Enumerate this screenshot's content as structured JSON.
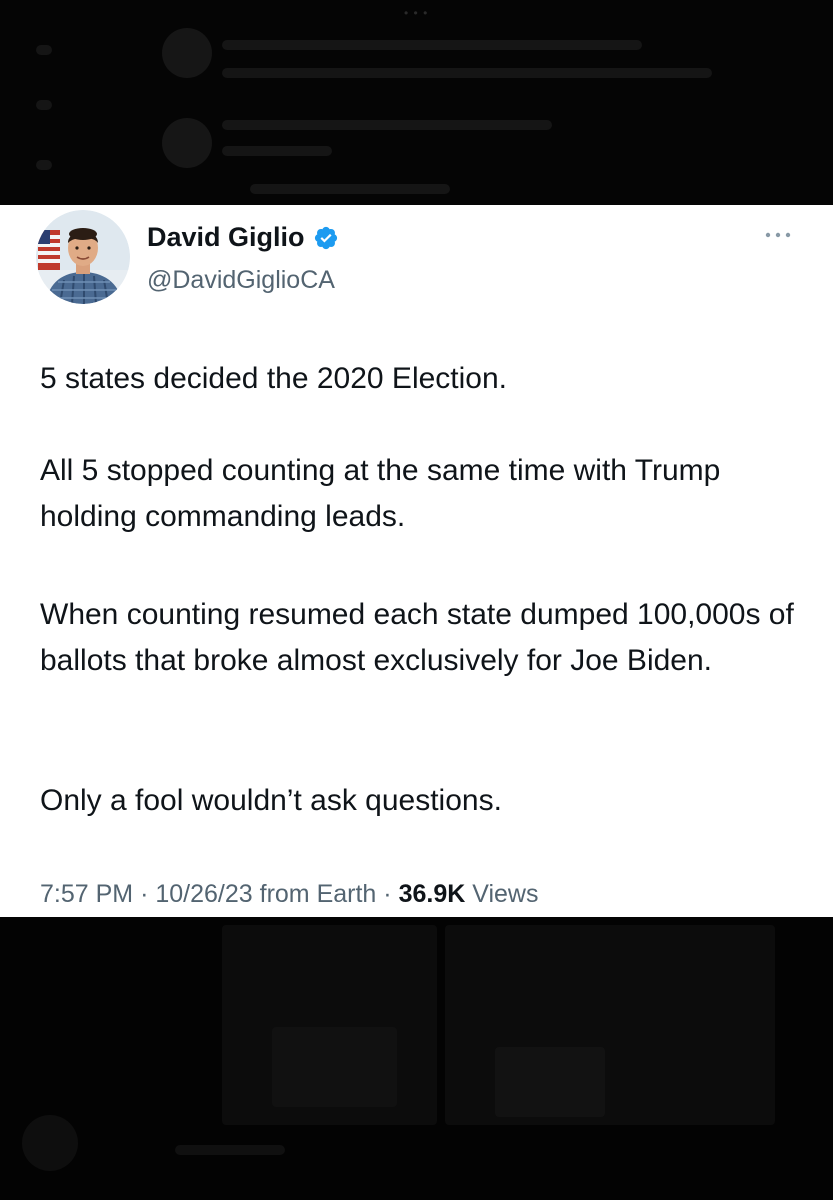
{
  "tweet": {
    "display_name": "David Giglio",
    "handle": "@DavidGiglioCA",
    "paragraphs": [
      "5 states decided the 2020 Election.",
      "All 5 stopped counting at the same time with Trump holding commanding leads.",
      "When counting resumed each state dumped 100,000s of ballots that broke almost exclusively for Joe Biden.",
      "Only a fool wouldn’t ask questions."
    ],
    "time": "7:57 PM",
    "separator": "·",
    "date": "10/26/23",
    "source": "from Earth",
    "views_count": "36.9K",
    "views_label": "Views"
  },
  "colors": {
    "verified_badge": "#1d9bf0",
    "name": "#0f1419",
    "secondary_text": "#536471"
  },
  "icons": [
    "verified-badge-icon",
    "more-options-icon"
  ]
}
